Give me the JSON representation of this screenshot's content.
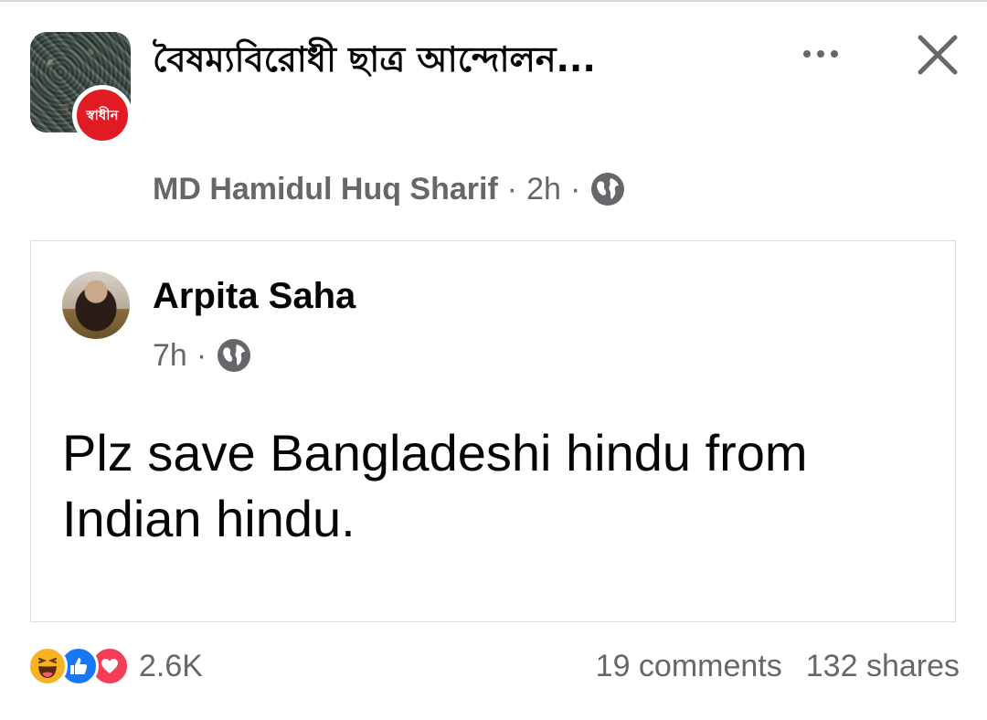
{
  "post": {
    "group_name": "বৈষম্যবিরোধী ছাত্র আন্দোলন...",
    "group_badge_text": "স্বাধীন",
    "author": "MD Hamidul Huq Sharif",
    "time": "2h",
    "separator": "·",
    "audience_icon": "globe-icon"
  },
  "shared_post": {
    "author": "Arpita Saha",
    "time": "7h",
    "separator": "·",
    "audience_icon": "globe-icon",
    "text": "Plz save Bangladeshi hindu from Indian hindu."
  },
  "footer": {
    "reaction_icons": [
      "haha-icon",
      "like-icon",
      "love-icon"
    ],
    "reaction_count": "2.6K",
    "comments": "19 comments",
    "shares": "132 shares"
  },
  "colors": {
    "text_primary": "#050505",
    "text_secondary": "#65676b",
    "badge_red": "#e01b24",
    "like_blue": "#1877f2",
    "love_red": "#f33e58",
    "haha_yellow": "#f7b125",
    "border": "#dcdde0"
  }
}
